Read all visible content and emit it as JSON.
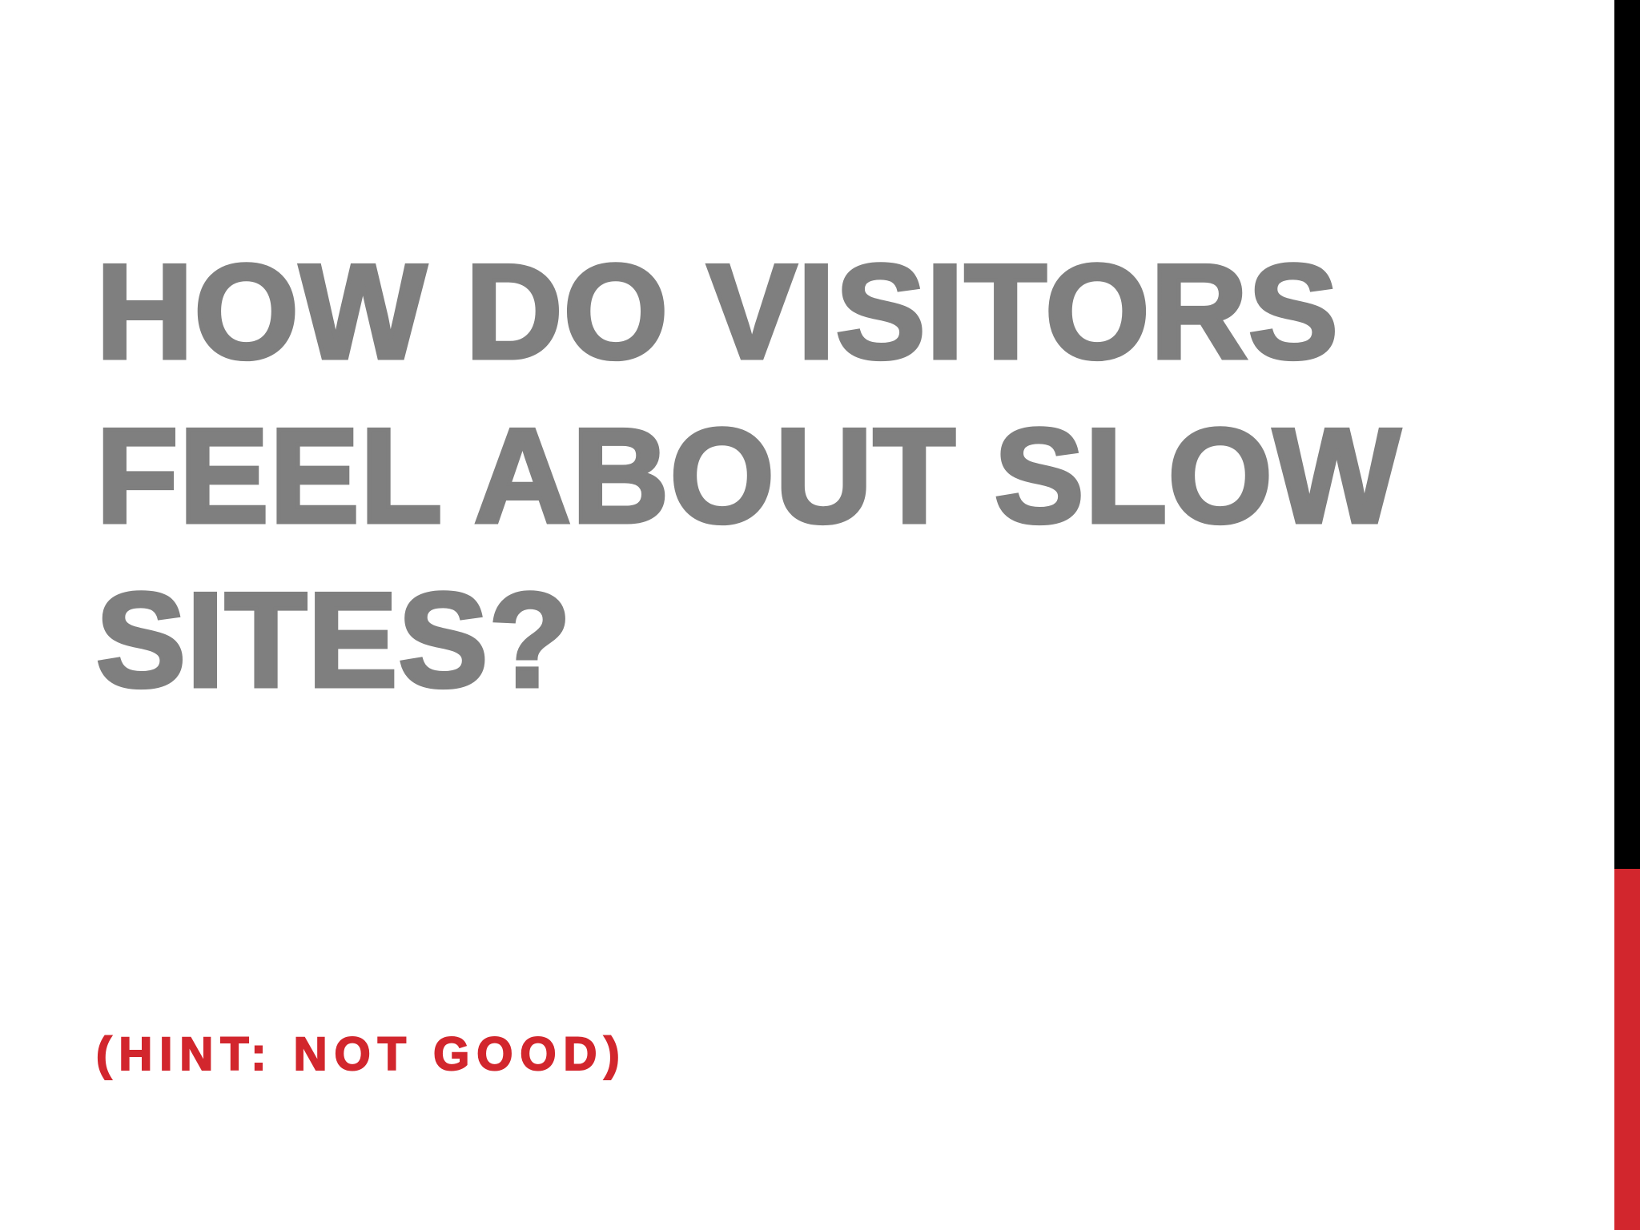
{
  "slide": {
    "title": "How do visitors feel about slow sites?",
    "subtitle": "(Hint: Not good)"
  },
  "colors": {
    "title": "#7f7f7f",
    "subtitle": "#d2262d",
    "accent_bar_top": "#000000",
    "accent_bar_bottom": "#d2262d",
    "background": "#ffffff"
  }
}
